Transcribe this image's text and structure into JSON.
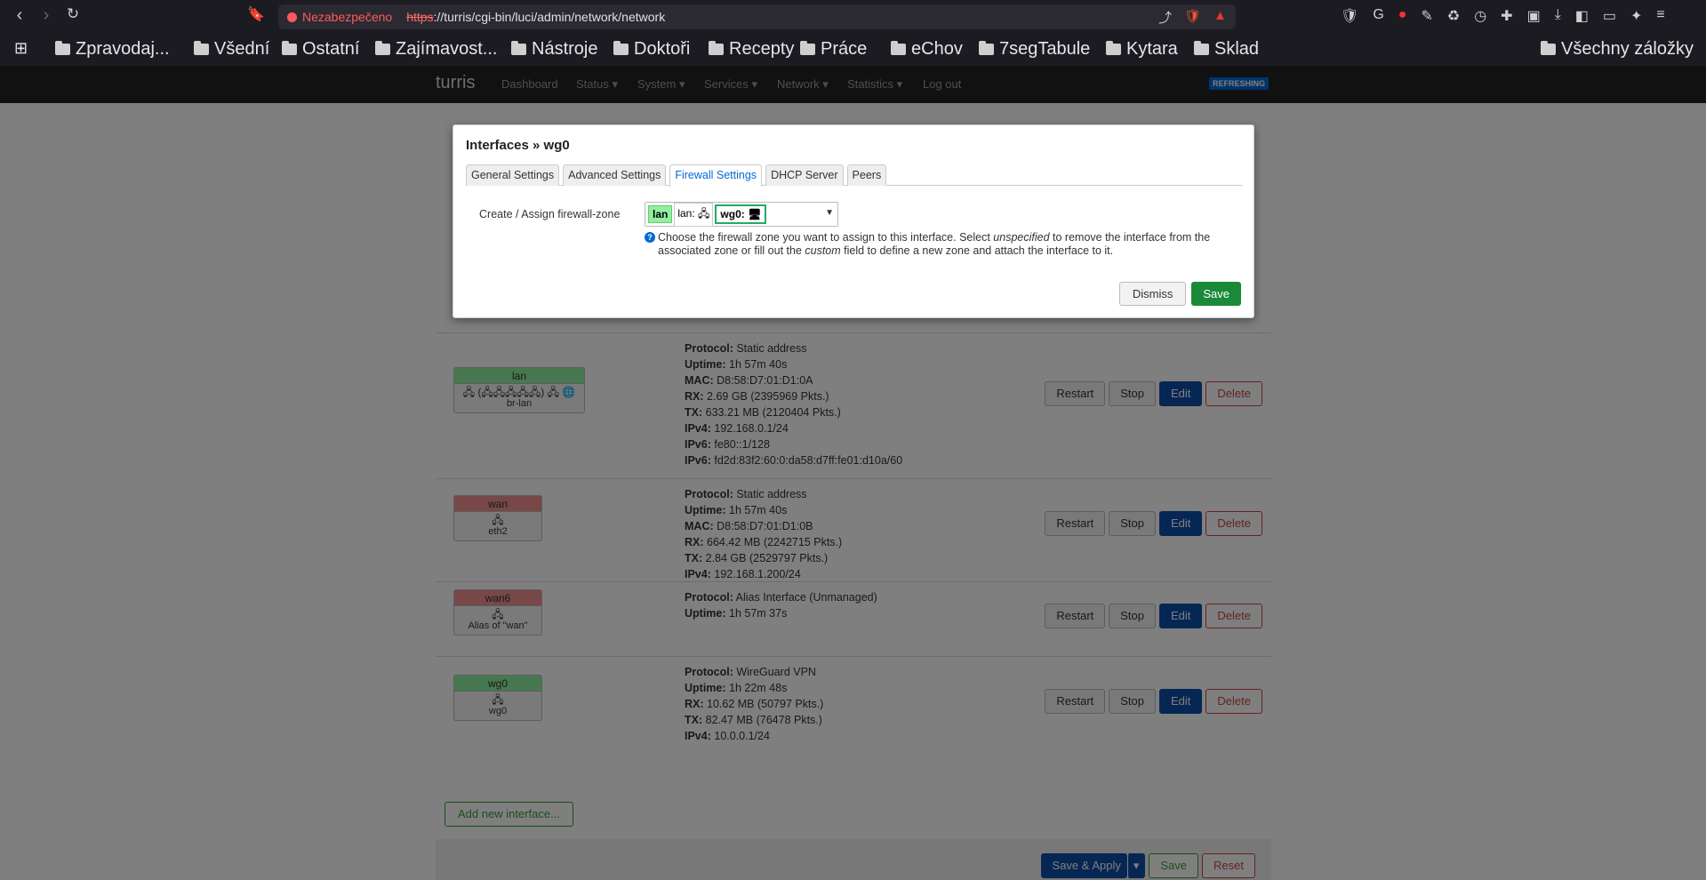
{
  "browser": {
    "security_label": "Nezabezpečeno",
    "url_scheme": "https",
    "url_rest": "://turris/cgi-bin/luci/admin/network/network",
    "bookmarks": [
      "Zpravodaj...",
      "Všední",
      "Ostatní",
      "Zajímavost...",
      "Nástroje",
      "Doktoři",
      "Recepty",
      "Práce",
      "eChov",
      "7segTabule",
      "Kytara",
      "Sklad"
    ],
    "all_bookmarks": "Všechny záložky"
  },
  "navbar": {
    "brand": "turris",
    "items": [
      "Dashboard",
      "Status ▾",
      "System ▾",
      "Services ▾",
      "Network ▾",
      "Statistics ▾",
      "Log out"
    ],
    "refresh_badge": "REFRESHING"
  },
  "interfaces": [
    {
      "name": "lan",
      "color": "green",
      "icon": "🖧 (🖧🖧🖧🖧🖧) 🖧 🌐",
      "device": "br-lan",
      "info": [
        [
          "Protocol:",
          "Static address"
        ],
        [
          "Uptime:",
          "1h 57m 40s"
        ],
        [
          "MAC:",
          "D8:58:D7:01:D1:0A"
        ],
        [
          "RX:",
          "2.69 GB (2395969 Pkts.)"
        ],
        [
          "TX:",
          "633.21 MB (2120404 Pkts.)"
        ],
        [
          "IPv4:",
          "192.168.0.1/24"
        ],
        [
          "IPv6:",
          "fe80::1/128"
        ],
        [
          "IPv6:",
          "fd2d:83f2:60:0:da58:d7ff:fe01:d10a/60"
        ]
      ]
    },
    {
      "name": "wan",
      "color": "red",
      "icon": "🖧",
      "device": "eth2",
      "info": [
        [
          "Protocol:",
          "Static address"
        ],
        [
          "Uptime:",
          "1h 57m 40s"
        ],
        [
          "MAC:",
          "D8:58:D7:01:D1:0B"
        ],
        [
          "RX:",
          "664.42 MB (2242715 Pkts.)"
        ],
        [
          "TX:",
          "2.84 GB (2529797 Pkts.)"
        ],
        [
          "IPv4:",
          "192.168.1.200/24"
        ]
      ]
    },
    {
      "name": "wan6",
      "color": "red",
      "icon": "🖧",
      "device": "Alias of \"wan\"",
      "info": [
        [
          "Protocol:",
          "Alias Interface (Unmanaged)"
        ],
        [
          "Uptime:",
          "1h 57m 37s"
        ]
      ]
    },
    {
      "name": "wg0",
      "color": "green",
      "icon": "🖧",
      "device": "wg0",
      "info": [
        [
          "Protocol:",
          "WireGuard VPN"
        ],
        [
          "Uptime:",
          "1h 22m 48s"
        ],
        [
          "RX:",
          "10.62 MB (50797 Pkts.)"
        ],
        [
          "TX:",
          "82.47 MB (76478 Pkts.)"
        ],
        [
          "IPv4:",
          "10.0.0.1/24"
        ]
      ]
    }
  ],
  "row_buttons": {
    "restart": "Restart",
    "stop": "Stop",
    "edit": "Edit",
    "delete": "Delete"
  },
  "add_interface": "Add new interface...",
  "footer": {
    "save_apply": "Save & Apply",
    "dropdown": "▾",
    "save": "Save",
    "reset": "Reset"
  },
  "modal": {
    "title": "Interfaces » wg0",
    "tabs": [
      "General Settings",
      "Advanced Settings",
      "Firewall Settings",
      "DHCP Server",
      "Peers"
    ],
    "active_tab": "Firewall Settings",
    "zone_label": "Create / Assign firewall-zone",
    "zone_lan": "lan",
    "zone_lan_if": "lan: 🖧",
    "zone_wg": "wg0: 🖥",
    "help_1": "Choose the firewall zone you want to assign to this interface. Select ",
    "help_em1": "unspecified",
    "help_2": " to remove the interface from the associated zone or fill out the ",
    "help_em2": "custom",
    "help_3": " field to define a new zone and attach the interface to it.",
    "dismiss": "Dismiss",
    "save": "Save"
  }
}
